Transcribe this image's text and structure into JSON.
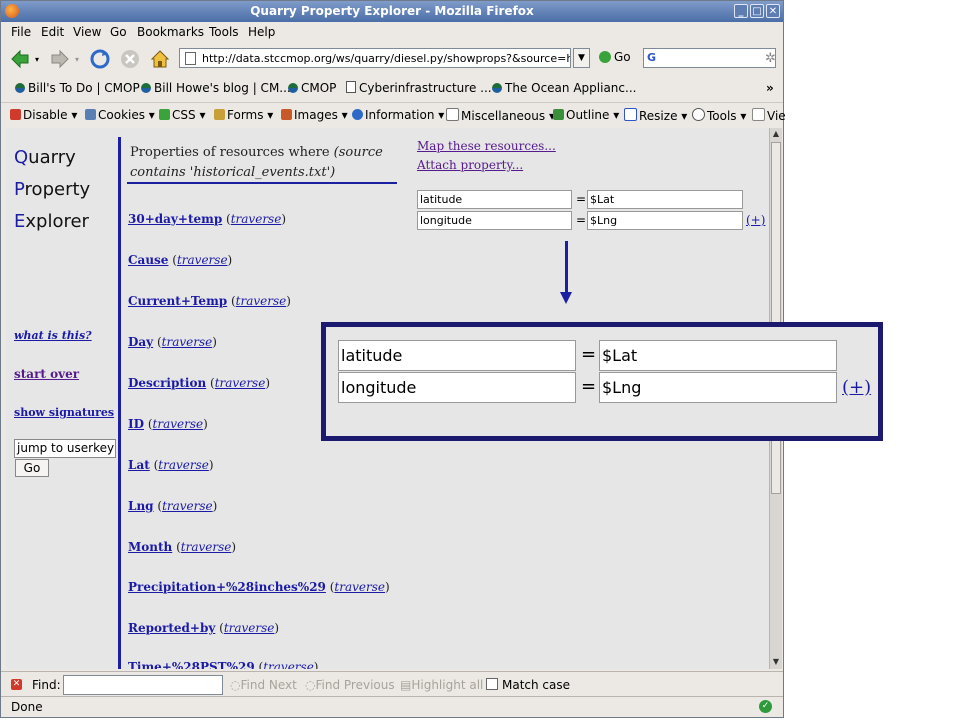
{
  "window": {
    "title": "Quarry Property Explorer - Mozilla Firefox",
    "controls": {
      "minimize": "_",
      "maximize": "□",
      "close": "✕"
    }
  },
  "menubar": {
    "items": [
      {
        "label": "File",
        "key": "F"
      },
      {
        "label": "Edit",
        "key": "E"
      },
      {
        "label": "View",
        "key": "V"
      },
      {
        "label": "Go",
        "key": "G"
      },
      {
        "label": "Bookmarks",
        "key": "B"
      },
      {
        "label": "Tools",
        "key": "T"
      },
      {
        "label": "Help",
        "key": "H"
      }
    ]
  },
  "navbar": {
    "url": "http://data.stccmop.org/ws/quarry/diesel.py/showprops?&source=h",
    "go_label": "Go",
    "search_logo": "G"
  },
  "bookmarks": {
    "items": [
      {
        "label": "Bill's To Do | CMOP",
        "icon": "cmop-icon"
      },
      {
        "label": "Bill Howe's blog | CM...",
        "icon": "cmop-icon"
      },
      {
        "label": "CMOP",
        "icon": "cmop-icon"
      },
      {
        "label": "Cyberinfrastructure ...",
        "icon": "page-icon"
      },
      {
        "label": "The Ocean Applianc...",
        "icon": "cmop-icon"
      }
    ],
    "overflow": "»"
  },
  "devtoolbar": {
    "items": [
      {
        "label": "Disable",
        "icon": "disable-icon"
      },
      {
        "label": "Cookies",
        "icon": "cookies-icon"
      },
      {
        "label": "CSS",
        "icon": "css-icon"
      },
      {
        "label": "Forms",
        "icon": "forms-icon"
      },
      {
        "label": "Images",
        "icon": "images-icon"
      },
      {
        "label": "Information",
        "icon": "information-icon"
      },
      {
        "label": "Miscellaneous",
        "icon": "miscellaneous-icon"
      },
      {
        "label": "Outline",
        "icon": "outline-icon"
      },
      {
        "label": "Resize",
        "icon": "resize-icon"
      },
      {
        "label": "Tools",
        "icon": "tools-icon"
      },
      {
        "label": "Vie",
        "icon": "view-source-icon"
      }
    ],
    "colors": {
      "disable": "#d03a2a",
      "cookies": "#5a7fb5",
      "css": "#3ba33b",
      "forms": "#c8a03a",
      "images": "#c85a2a",
      "information": "#2d6ac8",
      "miscellaneous": "#777777",
      "outline": "#3b8f3b",
      "resize": "#2d56c6",
      "tools": "#555555",
      "view": "#888888"
    }
  },
  "sidebar": {
    "logo": [
      {
        "cap": "Q",
        "rest": "uarry"
      },
      {
        "cap": "P",
        "rest": "roperty"
      },
      {
        "cap": "E",
        "rest": "xplorer"
      }
    ],
    "what_is_this": "what is this?",
    "start_over": "start over",
    "show_signatures": "show signatures",
    "jump_value": "jump to userkey",
    "go_label": "Go"
  },
  "main": {
    "heading_prefix": "Properties of resources where ",
    "heading_condition": "(source contains 'historical_events.txt')",
    "properties": [
      {
        "name": "30+day+temp",
        "link": "traverse"
      },
      {
        "name": "Cause",
        "link": "traverse"
      },
      {
        "name": "Current+Temp",
        "link": "traverse"
      },
      {
        "name": "Day",
        "link": "traverse"
      },
      {
        "name": "Description",
        "link": "traverse"
      },
      {
        "name": "ID",
        "link": "traverse"
      },
      {
        "name": "Lat",
        "link": "traverse"
      },
      {
        "name": "Lng",
        "link": "traverse"
      },
      {
        "name": "Month",
        "link": "traverse"
      },
      {
        "name": "Precipitation+%28inches%29",
        "link": "traverse"
      },
      {
        "name": "Reported+by",
        "link": "traverse"
      },
      {
        "name": "Time+%28PST%29",
        "link": "traverse"
      }
    ],
    "actions": {
      "map": "Map these resources...",
      "attach": "Attach property..."
    },
    "mapping": [
      {
        "field": "latitude",
        "eq": "=",
        "value": "$Lat"
      },
      {
        "field": "longitude",
        "eq": "=",
        "value": "$Lng"
      }
    ],
    "add_label": "(+)"
  },
  "callout": {
    "mapping": [
      {
        "field": "latitude",
        "eq": "=",
        "value": "$Lat"
      },
      {
        "field": "longitude",
        "eq": "=",
        "value": "$Lng"
      }
    ],
    "add_label": "(+)",
    "border_color": "#1b1a6e"
  },
  "findbar": {
    "label": "Find:",
    "next": "Find Next",
    "previous": "Find Previous",
    "highlight": "Highlight all",
    "match_case": "Match case"
  },
  "status": {
    "text": "Done"
  }
}
